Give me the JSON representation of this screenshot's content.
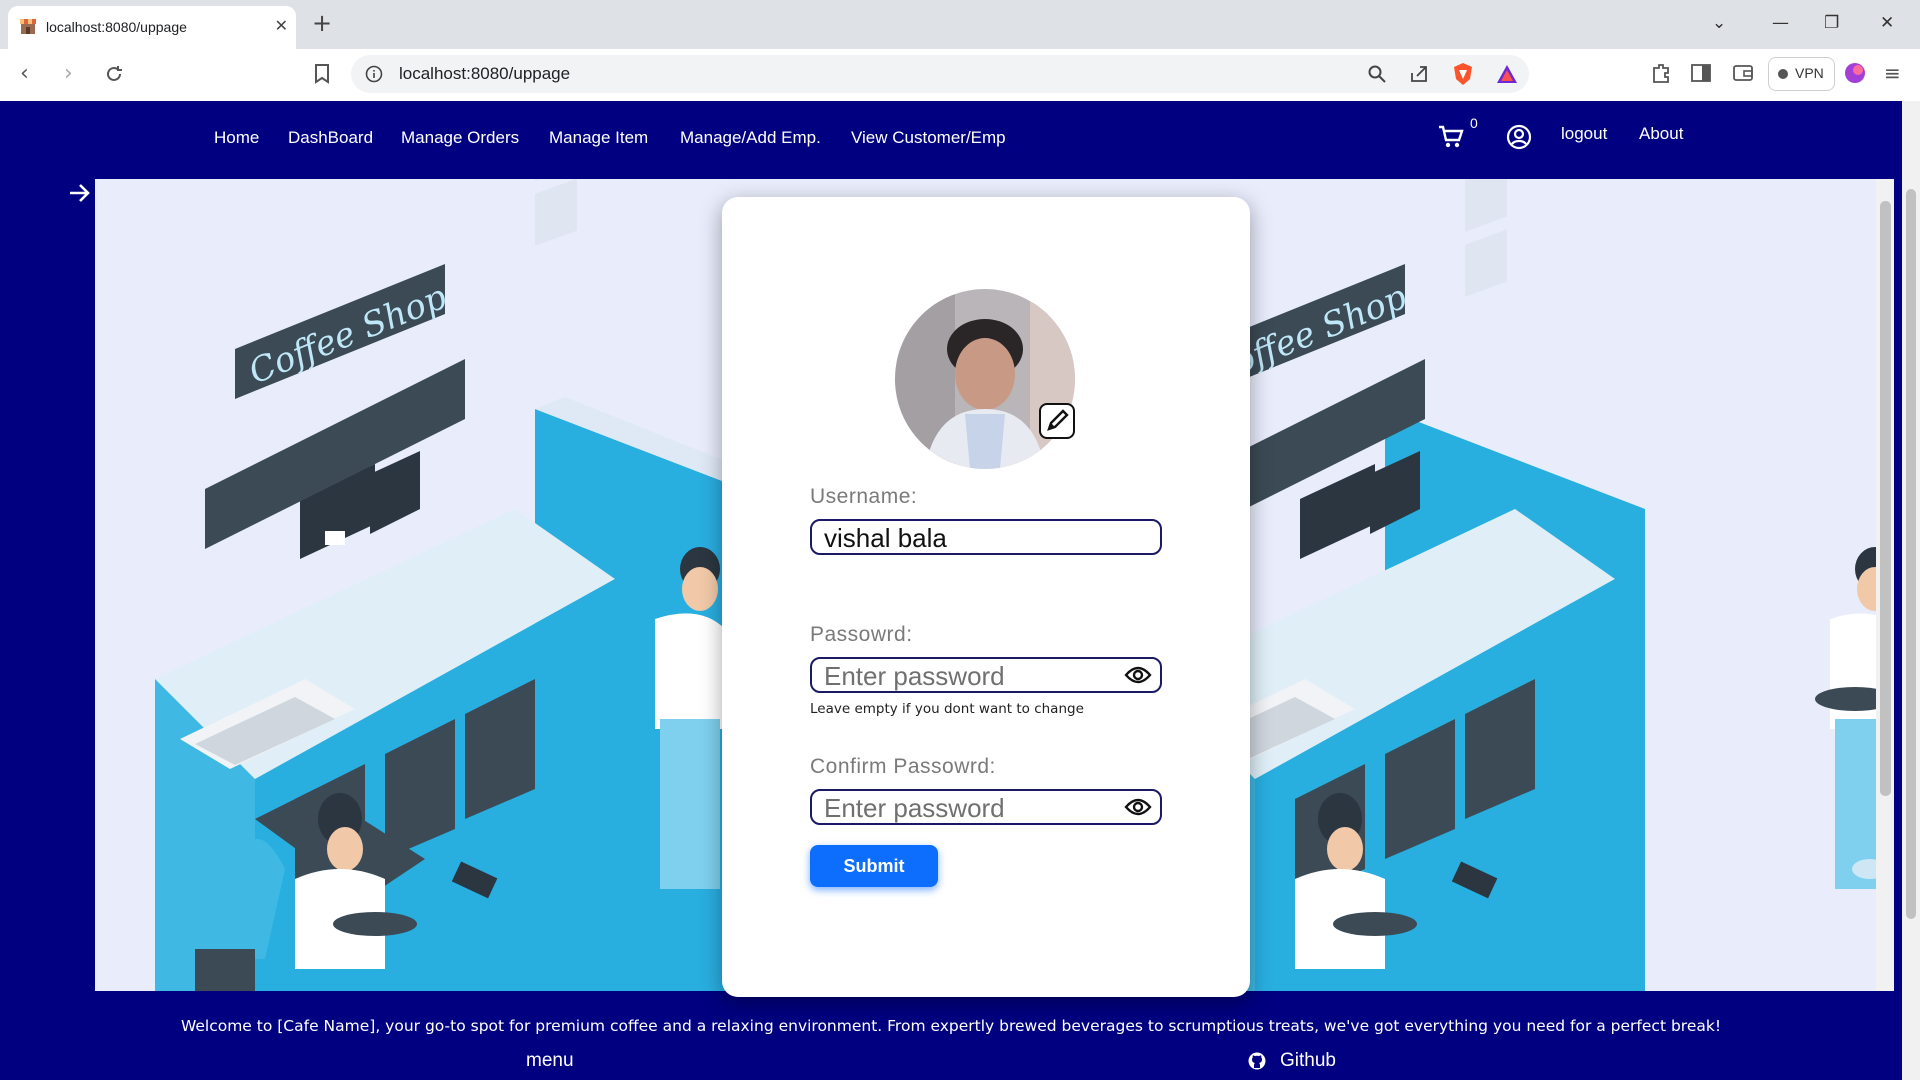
{
  "browser": {
    "tab_title": "localhost:8080/uppage",
    "url": "localhost:8080/uppage",
    "vpn_label": "VPN"
  },
  "nav": {
    "links": [
      "Home",
      "DashBoard",
      "Manage Orders",
      "Manage Item",
      "Manage/Add Emp.",
      "View Customer/Emp"
    ],
    "cart_count": "0",
    "logout": "logout",
    "about": "About"
  },
  "scene": {
    "sign_text": "Coffee Shop"
  },
  "form": {
    "username_label": "Username:",
    "username_value": "vishal bala",
    "password_label": "Passowrd:",
    "password_placeholder": "Enter password",
    "password_hint": "Leave empty if you dont want to change",
    "confirm_label": "Confirm Passowrd:",
    "confirm_placeholder": "Enter password",
    "submit_label": "Submit"
  },
  "footer": {
    "welcome_text": "Welcome to [Cafe Name], your go-to spot for premium coffee and a relaxing environment. From expertly brewed beverages to scrumptious treats, we've got everything you need for a perfect break!",
    "menu_label": "menu",
    "github_label": "Github"
  },
  "colors": {
    "page_bg": "#000080",
    "accent": "#0d6efd",
    "scene_blue": "#29aee0",
    "scene_dark": "#3b4a55"
  }
}
